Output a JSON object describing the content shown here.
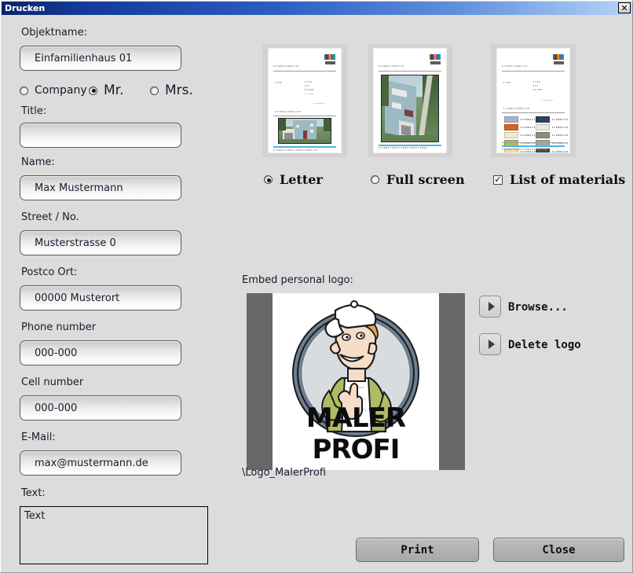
{
  "window": {
    "title": "Drucken",
    "close_icon": "close-icon",
    "close_glyph": "✕"
  },
  "form": {
    "object_name_label": "Objektname:",
    "object_name_value": "Einfamilienhaus 01",
    "salutation": {
      "company_label": "Company",
      "mr_label": "Mr.",
      "mrs_label": "Mrs.",
      "selected": "Mr."
    },
    "title_label": "Title:",
    "title_value": "",
    "name_label": "Name:",
    "name_value": "Max Mustermann",
    "street_label": "Street / No.",
    "street_value": "Musterstrasse 0",
    "postcode_label": "Postco   Ort:",
    "postcode_value": "00000 Musterort",
    "phone_label": "Phone number",
    "phone_value": "000-000",
    "cell_label": "Cell number",
    "cell_value": "000-000",
    "email_label": "E-Mail:",
    "email_value": "max@mustermann.de",
    "text_label": "Text:",
    "text_value": "Text"
  },
  "print_options": [
    {
      "label": "Letter",
      "type": "radio",
      "checked": true,
      "name": "option-letter"
    },
    {
      "label": "Full screen",
      "type": "radio",
      "checked": false,
      "name": "option-full-screen"
    },
    {
      "label": "List of materials",
      "type": "checkbox",
      "checked": true,
      "name": "option-list-of-materials"
    }
  ],
  "checkmark_glyph": "✓",
  "logo": {
    "section_label": "Embed personal logo:",
    "path": "\\Logo_MalerProfi",
    "brand_text": "MALER PROFI",
    "browse_label": "Browse...",
    "delete_label": "Delete logo"
  },
  "actions": {
    "print_label": "Print",
    "close_label": "Close"
  },
  "material_swatches": {
    "left": [
      "#a9b6c2",
      "#d9621c",
      "#f2ead7",
      "#b3bc56",
      "#f2dcae",
      "#4e7a74",
      "#c6b395"
    ],
    "right": [
      "#2f3f5c",
      "#ece9df",
      "#8c8c82",
      "#a8a79c",
      "#4c4c4c",
      "#3a3a3a",
      "#e9e9e1"
    ]
  },
  "colors": {
    "titlebar_start": "#0a246a",
    "titlebar_end": "#b8d4f6",
    "dialog_bg": "#dcdcdc",
    "accent_footer": "#4cb4e6",
    "logo_shirt": "#b0bc63",
    "logo_ring": "#6d7f92",
    "house_wall": "#9dbac4"
  }
}
